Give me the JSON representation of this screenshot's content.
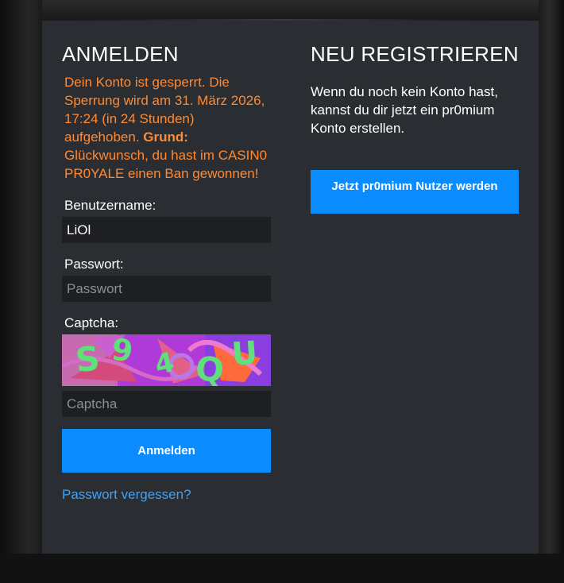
{
  "login": {
    "heading": "ANMELDEN",
    "error_prefix": "Dein Konto ist gesperrt. Die Sperrung wird am 31. März 2026, 17:24 (in 24 Stunden) aufgehoben. ",
    "error_reason_label": "Grund:",
    "error_reason": " Glückwunsch, du hast im CASIN0 PR0YALE einen Ban gewonnen!",
    "username_label": "Benutzername:",
    "username_value": "LiOl",
    "password_label": "Passwort:",
    "password_placeholder": "Passwort",
    "captcha_label": "Captcha:",
    "captcha_text": "S94QU",
    "captcha_placeholder": "Captcha",
    "submit_label": "Anmelden",
    "forgot_link": "Passwort vergessen?"
  },
  "register": {
    "heading": "NEU REGISTRIEREN",
    "text": "Wenn du noch kein Konto hast, kannst du dir jetzt ein pr0mium Konto erstellen.",
    "button_label": "Jetzt pr0mium Nutzer werden"
  },
  "colors": {
    "panel": "#2a2d31",
    "accent": "#0a8cff",
    "error": "#ff8a33",
    "link": "#3ea4ff"
  }
}
